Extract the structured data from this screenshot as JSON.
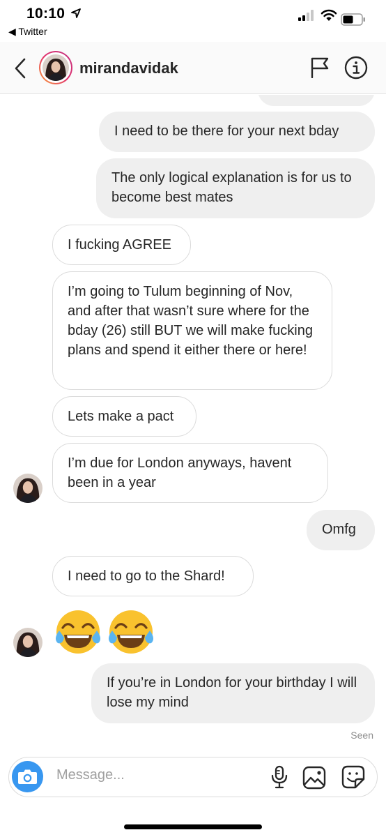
{
  "status": {
    "time": "10:10",
    "back_app": "◀ Twitter"
  },
  "header": {
    "username": "mirandavidak"
  },
  "messages": [
    {
      "from": "me",
      "text": "I need to be there for your next bday"
    },
    {
      "from": "me",
      "text": "The only logical explanation is for us to become best mates"
    },
    {
      "from": "them",
      "text": "I fucking AGREE"
    },
    {
      "from": "them",
      "text": "I’m going to Tulum beginning of Nov, and after that wasn’t sure where for the bday (26) still BUT we will make fucking plans and spend it either there or here!"
    },
    {
      "from": "them",
      "text": "Lets make a pact"
    },
    {
      "from": "them",
      "text": "I’m due for London anyways, havent been in a year"
    },
    {
      "from": "me",
      "text": "Omfg"
    },
    {
      "from": "them",
      "text": "I need to go to the Shard!"
    },
    {
      "from": "them",
      "text": "😂😂"
    },
    {
      "from": "me",
      "text": "If you’re in London for your birthday I will lose my mind"
    }
  ],
  "seen_label": "Seen",
  "composer": {
    "placeholder": "Message..."
  },
  "icons": [
    "back-chevron",
    "flag",
    "info",
    "camera",
    "microphone",
    "gallery",
    "sticker"
  ],
  "colors": {
    "outgoing_bubble": "#efefef",
    "incoming_border": "#dbdbdb",
    "camera_button": "#3897f0"
  }
}
